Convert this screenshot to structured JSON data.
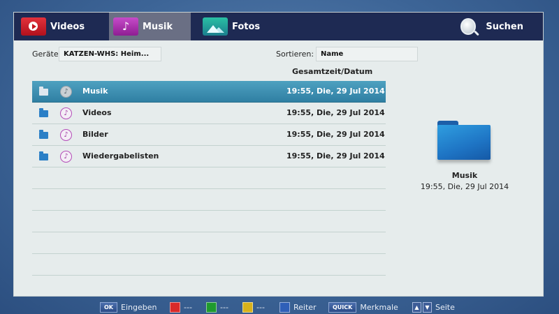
{
  "tabs": {
    "videos": "Videos",
    "musik": "Musik",
    "fotos": "Fotos",
    "search": "Suchen"
  },
  "filters": {
    "device_label": "Geräte:",
    "device_value": "KATZEN-WHS: Heim...",
    "sort_label": "Sortieren:",
    "sort_value": "Name"
  },
  "list": {
    "column_header": "Gesamtzeit/Datum",
    "rows": [
      {
        "name": "Musik",
        "date": "19:55, Die, 29 Jul 2014",
        "selected": true
      },
      {
        "name": "Videos",
        "date": "19:55, Die, 29 Jul 2014",
        "selected": false
      },
      {
        "name": "Bilder",
        "date": "19:55, Die, 29 Jul 2014",
        "selected": false
      },
      {
        "name": "Wiedergabelisten",
        "date": "19:55, Die, 29 Jul 2014",
        "selected": false
      }
    ]
  },
  "preview": {
    "name": "Musik",
    "date": "19:55, Die, 29 Jul 2014"
  },
  "footer": {
    "ok_key": "OK",
    "ok_label": "Eingeben",
    "red_label": "---",
    "green_label": "---",
    "yellow_label": "---",
    "blue_label": "Reiter",
    "quick_key": "QUICK",
    "quick_label": "Merkmale",
    "page_label": "Seite"
  },
  "colors": {
    "red": "#d92a2a",
    "green": "#1f9a2e",
    "yellow": "#d8b21c",
    "blue": "#2f5fb8",
    "selection": "#3f93b6"
  }
}
